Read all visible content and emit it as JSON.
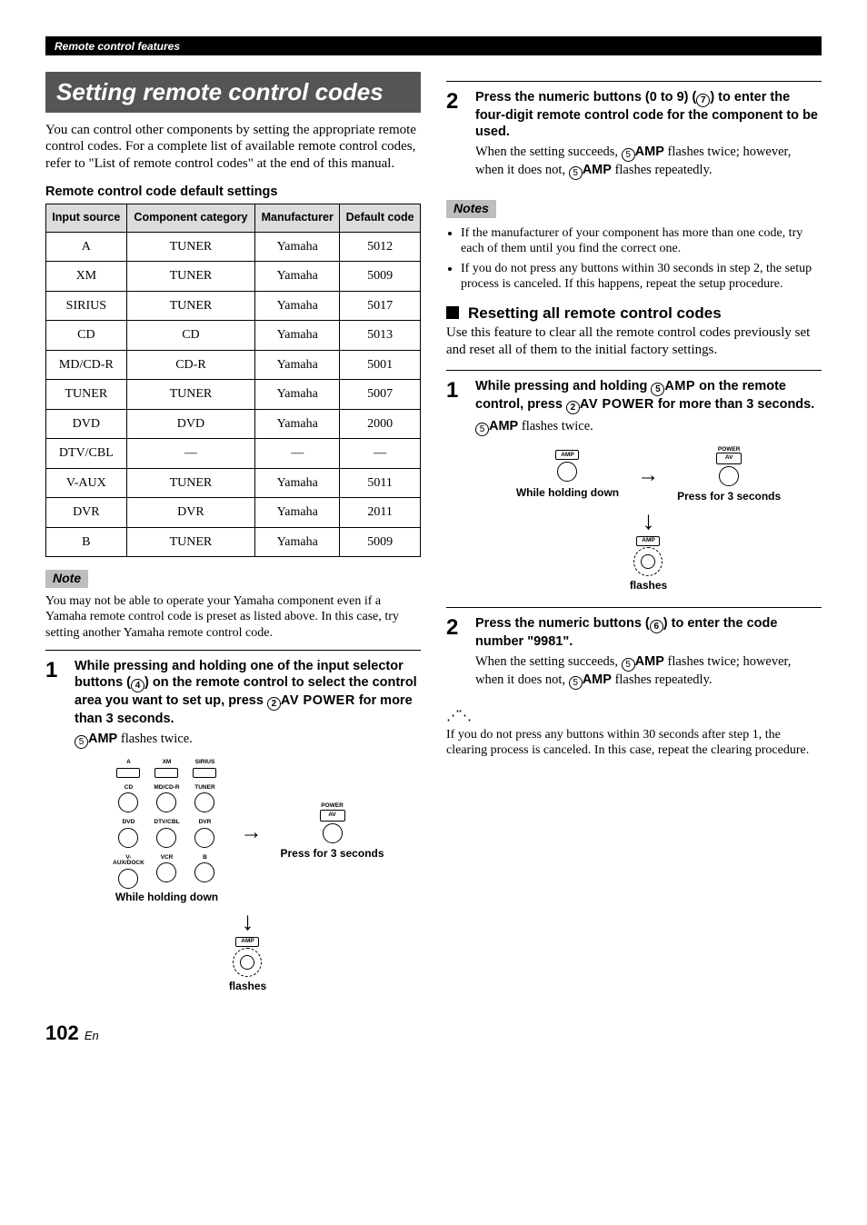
{
  "header": {
    "chapter": "Remote control features"
  },
  "section": {
    "title": "Setting remote control codes"
  },
  "intro": "You can control other components by setting the appropriate remote control codes. For a complete list of available remote control codes, refer to \"List of remote control codes\" at the end of this manual.",
  "table": {
    "caption": "Remote control code default settings",
    "headers": [
      "Input source",
      "Component category",
      "Manufacturer",
      "Default code"
    ],
    "rows": [
      [
        "A",
        "TUNER",
        "Yamaha",
        "5012"
      ],
      [
        "XM",
        "TUNER",
        "Yamaha",
        "5009"
      ],
      [
        "SIRIUS",
        "TUNER",
        "Yamaha",
        "5017"
      ],
      [
        "CD",
        "CD",
        "Yamaha",
        "5013"
      ],
      [
        "MD/CD-R",
        "CD-R",
        "Yamaha",
        "5001"
      ],
      [
        "TUNER",
        "TUNER",
        "Yamaha",
        "5007"
      ],
      [
        "DVD",
        "DVD",
        "Yamaha",
        "2000"
      ],
      [
        "DTV/CBL",
        "—",
        "—",
        "—"
      ],
      [
        "V-AUX",
        "TUNER",
        "Yamaha",
        "5011"
      ],
      [
        "DVR",
        "DVR",
        "Yamaha",
        "2011"
      ],
      [
        "B",
        "TUNER",
        "Yamaha",
        "5009"
      ]
    ]
  },
  "note1": {
    "label": "Note",
    "text": "You may not be able to operate your Yamaha component even if a Yamaha remote control code is preset as listed above. In this case, try setting another Yamaha remote control code."
  },
  "left_step1": {
    "num": "1",
    "lead_a": "While pressing and holding one of the input selector buttons (",
    "lead_circ1": "4",
    "lead_b": ") on the remote control to select the control area you want to set up, press ",
    "lead_circ2": "2",
    "lead_av": "AV POWER",
    "lead_c": " for more than 3 seconds.",
    "follow_circ": "5",
    "follow_amp": "AMP",
    "follow_text": " flashes twice."
  },
  "left_diagram": {
    "selector_rows": [
      [
        "A",
        "XM",
        "SIRIUS"
      ],
      [
        "CD",
        "MD/CD-R",
        "TUNER"
      ],
      [
        "DVD",
        "DTV/CBL",
        "DVR"
      ],
      [
        "V-AUX/DOCK",
        "VCR",
        "B"
      ]
    ],
    "hold_caption": "While holding down",
    "power_label": "POWER",
    "av_label": "AV",
    "press_caption": "Press for 3 seconds",
    "amp_label": "AMP",
    "flashes_caption": "flashes"
  },
  "right_step2": {
    "num": "2",
    "lead_a": "Press the numeric buttons (0 to 9) (",
    "lead_circ": "7",
    "lead_b": ") to enter the four-digit remote control code for the component to be used.",
    "follow_a": "When the setting succeeds, ",
    "follow_circ1": "5",
    "follow_amp1": "AMP",
    "follow_b": " flashes twice; however, when it does not, ",
    "follow_circ2": "5",
    "follow_amp2": "AMP",
    "follow_c": " flashes repeatedly."
  },
  "notes_right": {
    "label": "Notes",
    "items": [
      "If the manufacturer of your component has more than one code, try each of them until you find the correct one.",
      "If you do not press any buttons within 30 seconds in step 2, the setup process is canceled. If this happens, repeat the setup procedure."
    ]
  },
  "reset": {
    "title": "Resetting all remote control codes",
    "intro": "Use this feature to clear all the remote control codes previously set and reset all of them to the initial factory settings."
  },
  "reset_step1": {
    "num": "1",
    "lead_a": "While pressing and holding ",
    "lead_circ1": "5",
    "lead_amp": "AMP",
    "lead_b": " on the remote control, press ",
    "lead_circ2": "2",
    "lead_av": "AV POWER",
    "lead_c": " for more than 3 seconds.",
    "follow_circ": "5",
    "follow_amp": "AMP",
    "follow_text": " flashes twice."
  },
  "reset_diagram": {
    "amp_label": "AMP",
    "hold_caption": "While holding down",
    "power_label": "POWER",
    "av_label": "AV",
    "press_caption": "Press for 3 seconds",
    "flashes_caption": "flashes"
  },
  "reset_step2": {
    "num": "2",
    "lead_a": "Press the numeric buttons (",
    "lead_circ": "6",
    "lead_b": ") to enter the code number \"9981\".",
    "follow_a": "When the setting succeeds, ",
    "follow_circ1": "5",
    "follow_amp1": "AMP",
    "follow_b": " flashes twice; however, when it does not, ",
    "follow_circ2": "5",
    "follow_amp2": "AMP",
    "follow_c": " flashes repeatedly."
  },
  "tip": "If you do not press any buttons within 30 seconds after step 1, the clearing process is canceled. In this case, repeat the clearing procedure.",
  "page": {
    "num": "102",
    "suffix": "En"
  }
}
